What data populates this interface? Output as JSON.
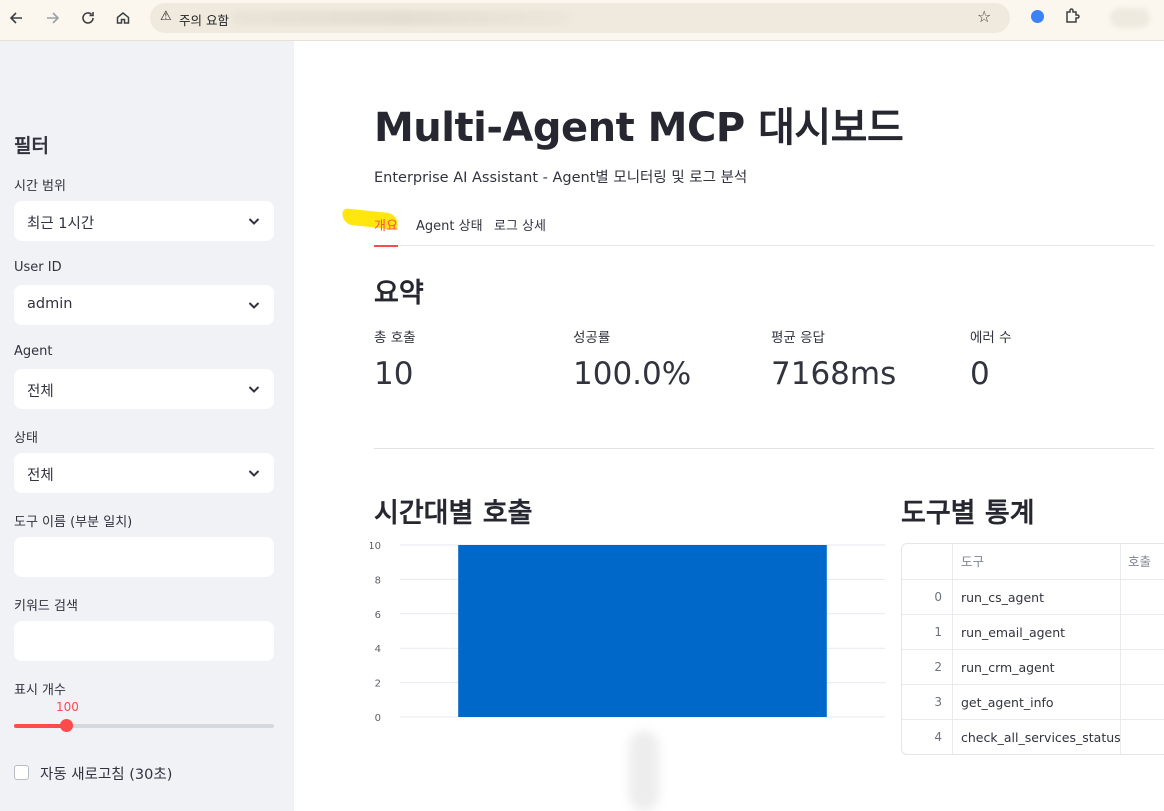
{
  "browser": {
    "address_warning": "주의 요함"
  },
  "sidebar": {
    "title": "필터",
    "time_range": {
      "label": "시간 범위",
      "value": "최근 1시간"
    },
    "user_id": {
      "label": "User ID",
      "value": "admin"
    },
    "agent": {
      "label": "Agent",
      "value": "전체"
    },
    "status": {
      "label": "상태",
      "value": "전체"
    },
    "tool_name": {
      "label": "도구 이름 (부분 일치)",
      "value": ""
    },
    "keyword": {
      "label": "키워드 검색",
      "value": ""
    },
    "display_count": {
      "label": "표시 개수",
      "value": "100",
      "fraction": 0.2
    },
    "auto_refresh": {
      "label": "자동 새로고침 (30초)",
      "checked": false
    }
  },
  "main": {
    "title": "Multi-Agent MCP 대시보드",
    "subtitle": "Enterprise AI Assistant - Agent별 모니터링 및 로그 분석",
    "tabs": [
      {
        "label": "개요",
        "active": true
      },
      {
        "label": "Agent 상태",
        "active": false
      },
      {
        "label": "로그 상세",
        "active": false
      }
    ],
    "summary": {
      "heading": "요약",
      "metrics": [
        {
          "label": "총 호출",
          "value": "10"
        },
        {
          "label": "성공률",
          "value": "100.0%"
        },
        {
          "label": "평균 응답",
          "value": "7168ms"
        },
        {
          "label": "에러 수",
          "value": "0"
        }
      ]
    },
    "hourly_heading": "시간대별 호출",
    "tools_heading": "도구별 통계",
    "tools_table": {
      "headers": [
        "도구",
        "호출"
      ],
      "rows": [
        {
          "index": "0",
          "tool": "run_cs_agent"
        },
        {
          "index": "1",
          "tool": "run_email_agent"
        },
        {
          "index": "2",
          "tool": "run_crm_agent"
        },
        {
          "index": "3",
          "tool": "get_agent_info"
        },
        {
          "index": "4",
          "tool": "check_all_services_status"
        }
      ]
    }
  },
  "colors": {
    "accent": "#ff4b4b",
    "bar": "#0068c9",
    "sidebar_bg": "#f0f2f6",
    "highlight": "#ffe600"
  },
  "chart_data": {
    "type": "bar",
    "categories": [
      ""
    ],
    "values": [
      10
    ],
    "title": "",
    "xlabel": "",
    "ylabel": "",
    "ylim": [
      0,
      10
    ],
    "yticks": [
      "0",
      "2",
      "4",
      "6",
      "8",
      "10"
    ],
    "grid": true
  }
}
